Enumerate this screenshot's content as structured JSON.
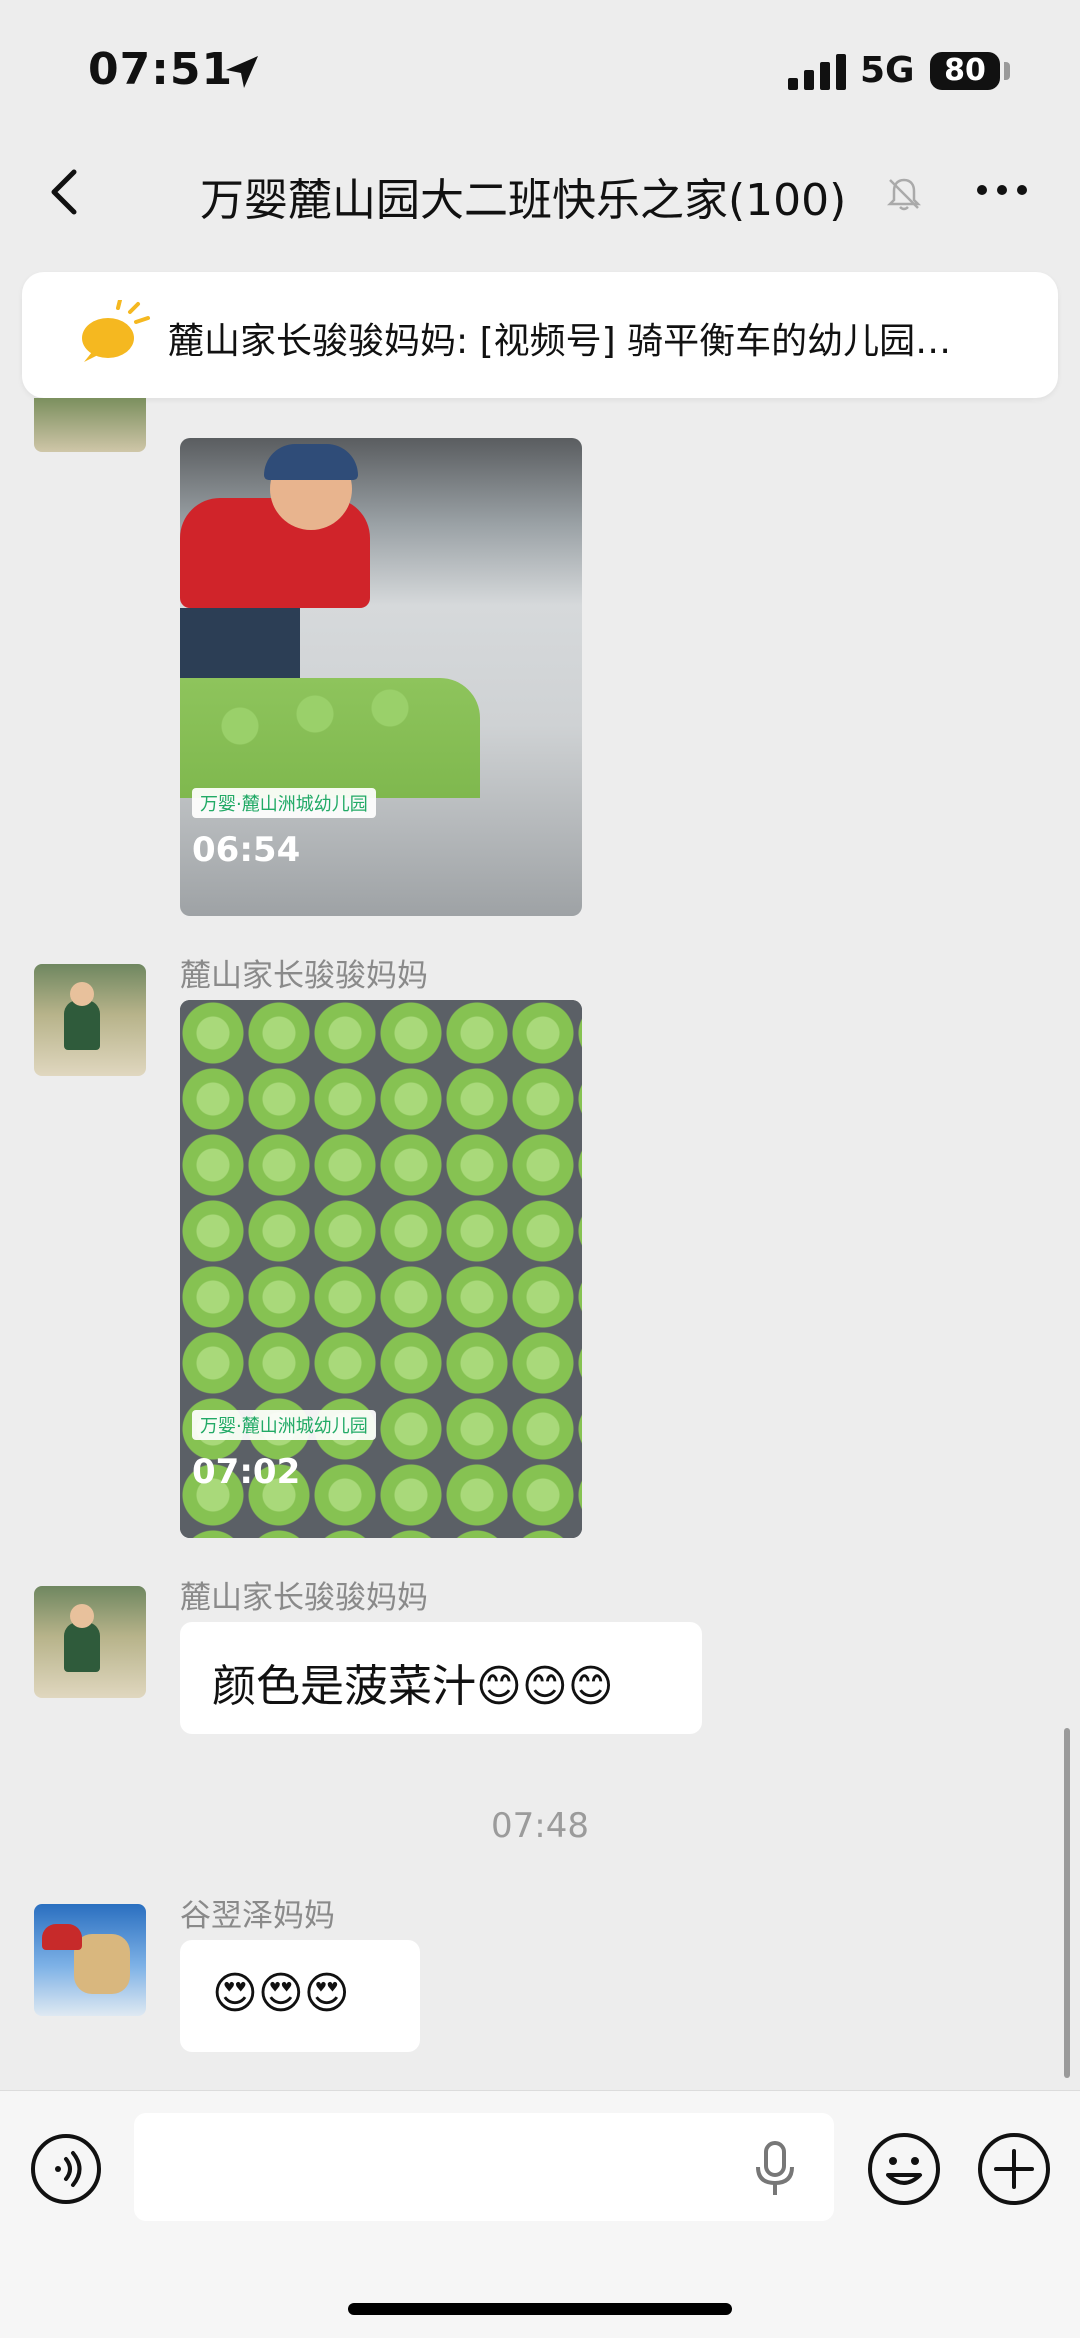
{
  "status_bar": {
    "time": "07:51",
    "network": "5G",
    "battery": "80"
  },
  "header": {
    "title": "万婴麓山园大二班快乐之家(100)"
  },
  "pinned": {
    "text": "麓山家长骏骏妈妈: [视频号] 骑平衡车的幼儿园…"
  },
  "messages": [
    {
      "type": "image",
      "watermark_time": "06:54",
      "watermark_brand": "万婴·麓山洲城幼儿园"
    },
    {
      "type": "image",
      "sender": "麓山家长骏骏妈妈",
      "watermark_time": "07:02",
      "watermark_brand": "万婴·麓山洲城幼儿园"
    },
    {
      "type": "text",
      "sender": "麓山家长骏骏妈妈",
      "text": "颜色是菠菜汁😊😊😊"
    },
    {
      "type": "time",
      "text": "07:48"
    },
    {
      "type": "text",
      "sender": "谷翌泽妈妈",
      "text": "😍😍😍"
    }
  ],
  "colors": {
    "background": "#ededed",
    "bubble": "#ffffff",
    "dough_green": "#8fc95a",
    "pin_icon": "#f5b820"
  }
}
